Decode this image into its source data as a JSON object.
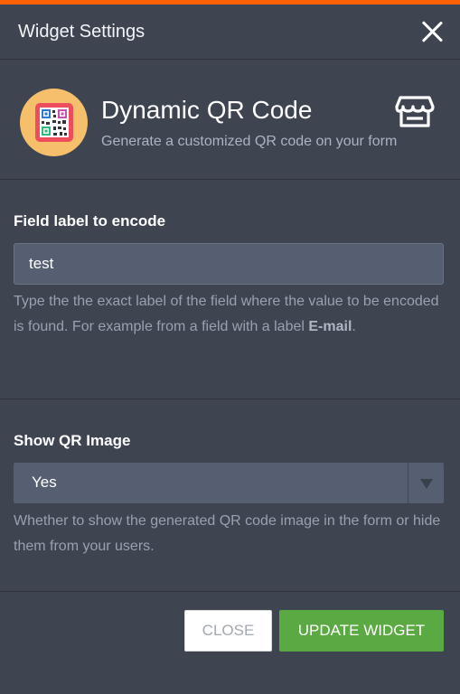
{
  "header": {
    "title": "Widget Settings",
    "close_icon": "close-icon"
  },
  "widget": {
    "name": "Dynamic QR Code",
    "description": "Generate a customized QR code on your form",
    "logo_icon": "qr-code-icon",
    "store_icon": "store-icon"
  },
  "field_label_section": {
    "label": "Field label to encode",
    "value": "test",
    "help_prefix": "Type the the exact label of the field where the value to be encoded is found. For example from a field with a label ",
    "help_bold": "E-mail",
    "help_suffix": "."
  },
  "show_qr_section": {
    "label": "Show QR Image",
    "selected": "Yes",
    "help": "Whether to show the generated QR code image in the form or hide them from your users."
  },
  "buttons": {
    "close": "CLOSE",
    "update": "UPDATE WIDGET"
  },
  "colors": {
    "accent": "#ff6100",
    "background": "#3e4551",
    "primary_button": "#5ba942",
    "logo_background": "#f6bf6b"
  }
}
